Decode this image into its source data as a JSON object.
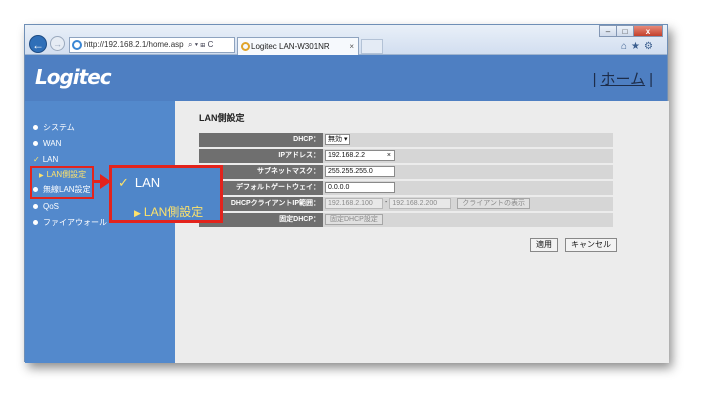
{
  "browser": {
    "address": "http://192.168.2.1/home.asp",
    "address_tools": "⌕ ▾ ⊞ C",
    "tab_title": "Logitec LAN-W301NR",
    "tab_close": "×",
    "window_buttons": [
      "–",
      "□",
      "x"
    ],
    "tool_icons": "⌂★⚙"
  },
  "header": {
    "logo": "Logitec",
    "home_link": "ホーム",
    "separator": "|"
  },
  "sidebar": {
    "items": [
      {
        "label": "システム"
      },
      {
        "label": "WAN"
      },
      {
        "label": "LAN"
      },
      {
        "label": "LAN側設定"
      },
      {
        "label": "無線LAN設定"
      },
      {
        "label": "QoS"
      },
      {
        "label": "ファイアウォール"
      }
    ]
  },
  "content": {
    "title": "LAN側設定",
    "rows": [
      {
        "label": "DHCP：",
        "select": "無効 ▾"
      },
      {
        "label": "IPアドレス：",
        "value": "192.168.2.2",
        "clear": "×"
      },
      {
        "label": "サブネットマスク：",
        "value": "255.255.255.0"
      },
      {
        "label": "デフォルトゲートウェイ：",
        "value": "0.0.0.0"
      },
      {
        "label": "DHCPクライアントIP範囲：",
        "start": "192.168.2.100",
        "dash": "-",
        "end": "192.168.2.200",
        "button": "クライアントの表示"
      },
      {
        "label": "固定DHCP：",
        "button": "固定DHCP設定"
      }
    ],
    "apply_button": "適用",
    "cancel_button": "キャンセル"
  },
  "callout": {
    "lan": "LAN",
    "sub": "LAN側設定"
  },
  "colors": {
    "banner": "#4e7fc2",
    "sidebar": "#5389cc",
    "highlight": "#e3231c",
    "submenu": "#ffe36a"
  }
}
